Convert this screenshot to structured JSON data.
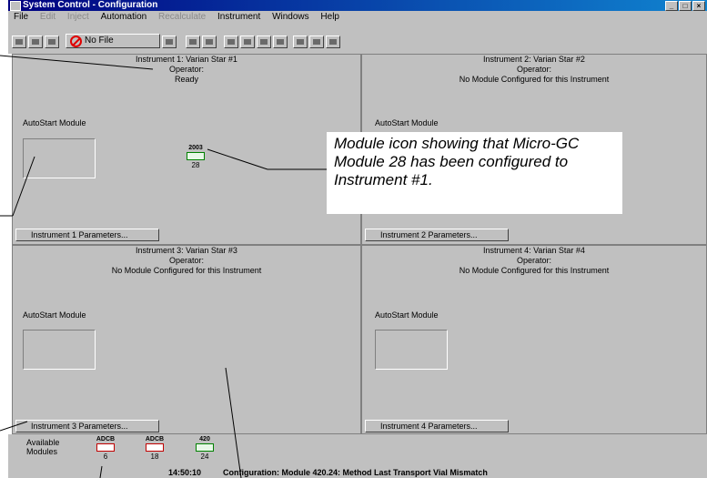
{
  "window": {
    "title": "System Control - Configuration"
  },
  "menu": [
    "File",
    "Edit",
    "Inject",
    "Automation",
    "Recalculate",
    "Instrument",
    "Windows",
    "Help"
  ],
  "menu_disabled": [
    "Edit",
    "Inject",
    "Recalculate"
  ],
  "toolbar": {
    "file_combo": "No File"
  },
  "instruments": [
    {
      "title": "Instrument 1: Varian Star #1",
      "operator": "Operator:",
      "status": "Ready",
      "autostart_label": "AutoStart Module",
      "params_button": "Instrument 1 Parameters..."
    },
    {
      "title": "Instrument 2: Varian Star #2",
      "operator": "Operator:",
      "status": "No Module Configured for this Instrument",
      "autostart_label": "AutoStart Module",
      "params_button": "Instrument 2 Parameters..."
    },
    {
      "title": "Instrument 3: Varian Star #3",
      "operator": "Operator:",
      "status": "No Module Configured for this Instrument",
      "autostart_label": "AutoStart Module",
      "params_button": "Instrument 3 Parameters..."
    },
    {
      "title": "Instrument 4: Varian Star #4",
      "operator": "Operator:",
      "status": "No Module Configured for this Instrument",
      "autostart_label": "AutoStart Module",
      "params_button": "Instrument 4 Parameters..."
    }
  ],
  "configured_module": {
    "label": "2003",
    "number": "28"
  },
  "available_modules": {
    "label_line1": "Available",
    "label_line2": "Modules",
    "items": [
      {
        "label": "ADCB",
        "number": "6"
      },
      {
        "label": "ADCB",
        "number": "18"
      },
      {
        "label": "420",
        "number": "24"
      }
    ]
  },
  "status_bar": {
    "time": "14:50:10",
    "message": "Configuration: Module 420.24: Method Last Transport Vial Mismatch"
  },
  "callout": "Module icon showing that Micro-GC Module 28 has been configured to Instrument #1."
}
